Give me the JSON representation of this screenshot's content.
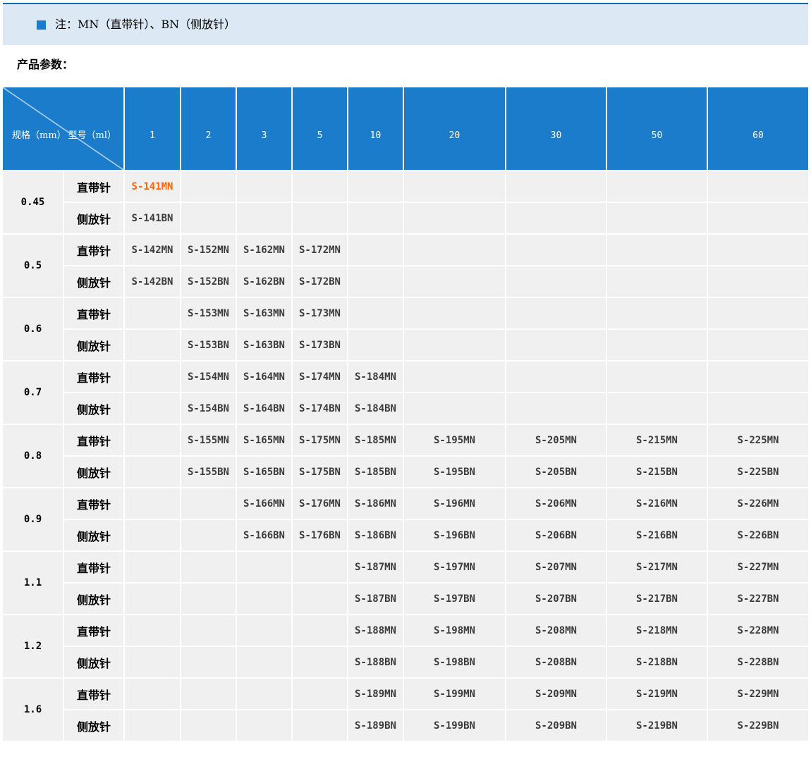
{
  "banner": {
    "icon": "blue-square-bullet",
    "text": "注：MN（直带针）、BN（侧放针）",
    "bg_color": "#dce9f5",
    "top_line_color": "#1169b8",
    "square_color": "#1b7ccc"
  },
  "heading": "产品参数：",
  "table": {
    "header": {
      "bg_color": "#1b7ccc",
      "text_color": "#ffffff",
      "corner_bottom_left": "规格（mm）",
      "corner_top_right": "型号（ml）",
      "columns": [
        "1",
        "2",
        "3",
        "5",
        "10",
        "20",
        "30",
        "50",
        "60"
      ]
    },
    "body_bg_color": "#f0f0f0",
    "row_type_labels": [
      "直带针",
      "侧放针"
    ],
    "highlight_color": "#ff6600",
    "highlight_cell": {
      "group_index": 0,
      "row_index": 0,
      "col_index": 0
    },
    "groups": [
      {
        "spec": "0.45",
        "rows": [
          [
            "S-141MN",
            "",
            "",
            "",
            "",
            "",
            "",
            "",
            ""
          ],
          [
            "S-141BN",
            "",
            "",
            "",
            "",
            "",
            "",
            "",
            ""
          ]
        ]
      },
      {
        "spec": "0.5",
        "rows": [
          [
            "S-142MN",
            "S-152MN",
            "S-162MN",
            "S-172MN",
            "",
            "",
            "",
            "",
            ""
          ],
          [
            "S-142BN",
            "S-152BN",
            "S-162BN",
            "S-172BN",
            "",
            "",
            "",
            "",
            ""
          ]
        ]
      },
      {
        "spec": "0.6",
        "rows": [
          [
            "",
            "S-153MN",
            "S-163MN",
            "S-173MN",
            "",
            "",
            "",
            "",
            ""
          ],
          [
            "",
            "S-153BN",
            "S-163BN",
            "S-173BN",
            "",
            "",
            "",
            "",
            ""
          ]
        ]
      },
      {
        "spec": "0.7",
        "rows": [
          [
            "",
            "S-154MN",
            "S-164MN",
            "S-174MN",
            "S-184MN",
            "",
            "",
            "",
            ""
          ],
          [
            "",
            "S-154BN",
            "S-164BN",
            "S-174BN",
            "S-184BN",
            "",
            "",
            "",
            ""
          ]
        ]
      },
      {
        "spec": "0.8",
        "rows": [
          [
            "",
            "S-155MN",
            "S-165MN",
            "S-175MN",
            "S-185MN",
            "S-195MN",
            "S-205MN",
            "S-215MN",
            "S-225MN"
          ],
          [
            "",
            "S-155BN",
            "S-165BN",
            "S-175BN",
            "S-185BN",
            "S-195BN",
            "S-205BN",
            "S-215BN",
            "S-225BN"
          ]
        ]
      },
      {
        "spec": "0.9",
        "rows": [
          [
            "",
            "",
            "S-166MN",
            "S-176MN",
            "S-186MN",
            "S-196MN",
            "S-206MN",
            "S-216MN",
            "S-226MN"
          ],
          [
            "",
            "",
            "S-166BN",
            "S-176BN",
            "S-186BN",
            "S-196BN",
            "S-206BN",
            "S-216BN",
            "S-226BN"
          ]
        ]
      },
      {
        "spec": "1.1",
        "rows": [
          [
            "",
            "",
            "",
            "",
            "S-187MN",
            "S-197MN",
            "S-207MN",
            "S-217MN",
            "S-227MN"
          ],
          [
            "",
            "",
            "",
            "",
            "S-187BN",
            "S-197BN",
            "S-207BN",
            "S-217BN",
            "S-227BN"
          ]
        ]
      },
      {
        "spec": "1.2",
        "rows": [
          [
            "",
            "",
            "",
            "",
            "S-188MN",
            "S-198MN",
            "S-208MN",
            "S-218MN",
            "S-228MN"
          ],
          [
            "",
            "",
            "",
            "",
            "S-188BN",
            "S-198BN",
            "S-208BN",
            "S-218BN",
            "S-228BN"
          ]
        ]
      },
      {
        "spec": "1.6",
        "rows": [
          [
            "",
            "",
            "",
            "",
            "S-189MN",
            "S-199MN",
            "S-209MN",
            "S-219MN",
            "S-229MN"
          ],
          [
            "",
            "",
            "",
            "",
            "S-189BN",
            "S-199BN",
            "S-209BN",
            "S-219BN",
            "S-229BN"
          ]
        ]
      }
    ]
  }
}
